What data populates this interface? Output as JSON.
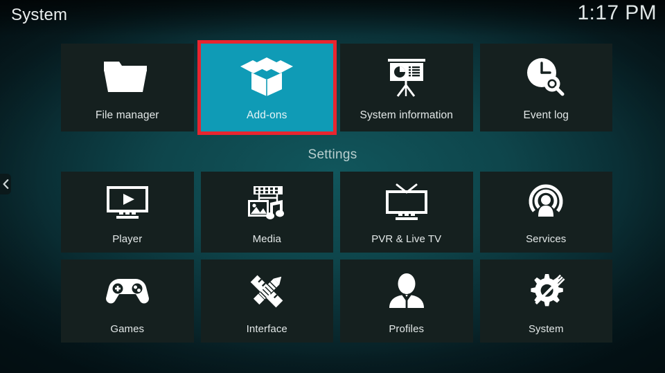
{
  "header": {
    "title": "System",
    "clock": "1:17 PM"
  },
  "nav": {
    "back_icon": "chevron-left-icon"
  },
  "colors": {
    "selected_tile_bg": "#0f9bb6",
    "selection_border": "#e8252f",
    "tile_bg": "#15201f",
    "label_text": "#e3e8e8",
    "caption_text": "#b9cfcf",
    "background_teal": "#11565c"
  },
  "sections": {
    "settings_caption": "Settings"
  },
  "top_row": [
    {
      "label": "File manager",
      "icon": "folder-icon",
      "selected": false
    },
    {
      "label": "Add-ons",
      "icon": "open-box-icon",
      "selected": true
    },
    {
      "label": "System information",
      "icon": "presentation-icon",
      "selected": false
    },
    {
      "label": "Event log",
      "icon": "clock-search-icon",
      "selected": false
    }
  ],
  "settings_rows": [
    [
      {
        "label": "Player",
        "icon": "monitor-play-icon",
        "selected": false
      },
      {
        "label": "Media",
        "icon": "media-library-icon",
        "selected": false
      },
      {
        "label": "PVR & Live TV",
        "icon": "tv-antenna-icon",
        "selected": false
      },
      {
        "label": "Services",
        "icon": "broadcast-user-icon",
        "selected": false
      }
    ],
    [
      {
        "label": "Games",
        "icon": "gamepad-icon",
        "selected": false
      },
      {
        "label": "Interface",
        "icon": "pencil-ruler-icon",
        "selected": false
      },
      {
        "label": "Profiles",
        "icon": "user-bust-icon",
        "selected": false
      },
      {
        "label": "System",
        "icon": "gear-wrench-icon",
        "selected": false
      }
    ]
  ]
}
